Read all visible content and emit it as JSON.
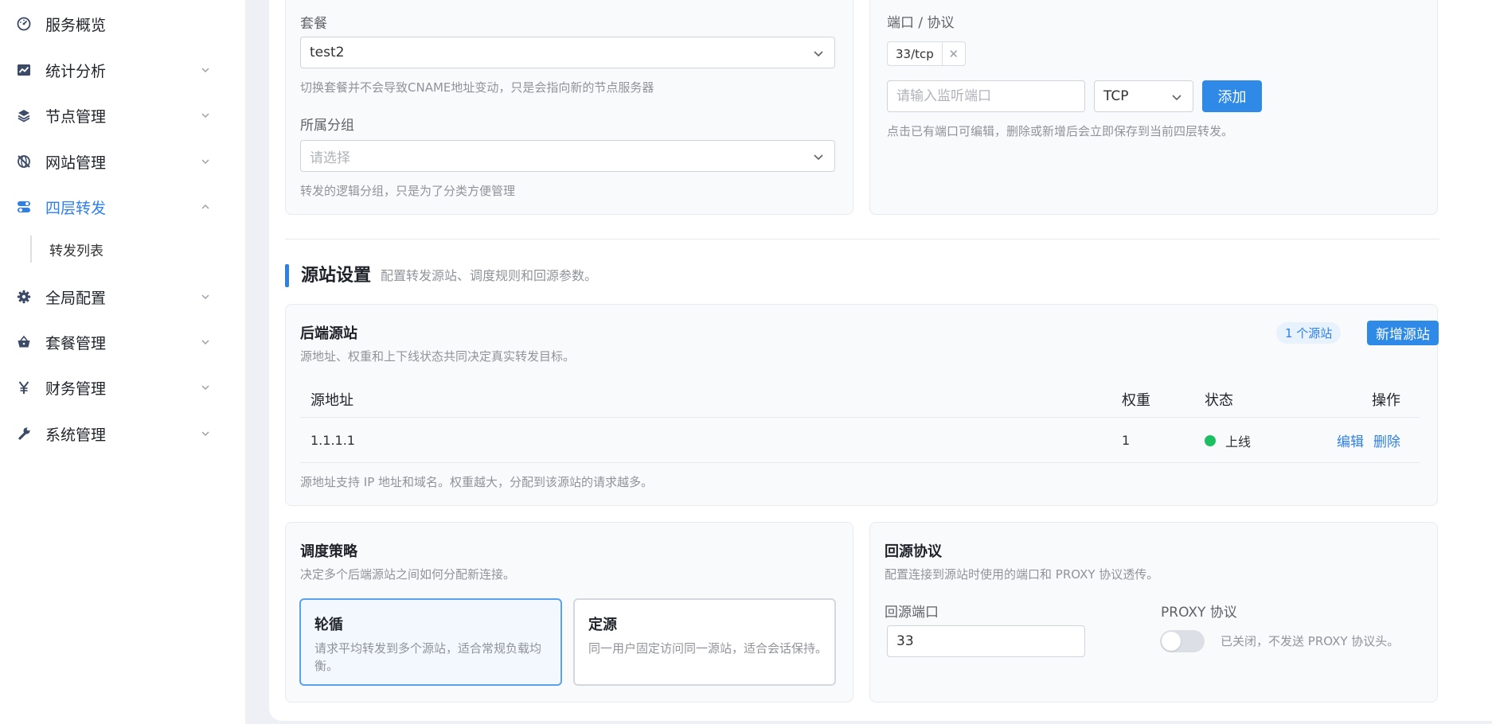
{
  "sidebar": {
    "items": [
      {
        "label": "服务概览",
        "icon": "gauge-icon"
      },
      {
        "label": "统计分析",
        "icon": "line-chart-icon"
      },
      {
        "label": "节点管理",
        "icon": "layers-icon"
      },
      {
        "label": "网站管理",
        "icon": "globe-off-icon"
      },
      {
        "label": "四层转发",
        "icon": "toggles-icon",
        "expanded": true
      },
      {
        "label": "全局配置",
        "icon": "gear-icon"
      },
      {
        "label": "套餐管理",
        "icon": "basket-icon"
      },
      {
        "label": "财务管理",
        "icon": "yen-icon"
      },
      {
        "label": "系统管理",
        "icon": "wrench-icon"
      }
    ],
    "subitems": [
      {
        "label": "转发列表"
      }
    ]
  },
  "form": {
    "package_label": "套餐",
    "package_value": "test2",
    "package_hint": "切换套餐并不会导致CNAME地址变动，只是会指向新的节点服务器",
    "group_label": "所属分组",
    "group_placeholder": "请选择",
    "group_hint": "转发的逻辑分组，只是为了分类方便管理",
    "ports_label": "端口 / 协议",
    "port_tags": [
      "33/tcp"
    ],
    "port_input_placeholder": "请输入监听端口",
    "protocol_value": "TCP",
    "add_button": "添加",
    "ports_hint": "点击已有端口可编辑，删除或新增后会立即保存到当前四层转发。"
  },
  "origin_section": {
    "title": "源站设置",
    "subtitle": "配置转发源站、调度规则和回源参数。"
  },
  "backend": {
    "title": "后端源站",
    "desc": "源地址、权重和上下线状态共同决定真实转发目标。",
    "count_badge": "1 个源站",
    "add_button": "新增源站",
    "columns": {
      "address": "源地址",
      "weight": "权重",
      "status": "状态",
      "actions": "操作"
    },
    "rows": [
      {
        "address": "1.1.1.1",
        "weight": "1",
        "status": "上线",
        "status_color": "#1dbf63",
        "edit": "编辑",
        "delete": "删除"
      }
    ],
    "hint": "源地址支持 IP 地址和域名。权重越大，分配到该源站的请求越多。"
  },
  "schedule": {
    "title": "调度策略",
    "desc": "决定多个后端源站之间如何分配新连接。",
    "options": [
      {
        "title": "轮循",
        "desc": "请求平均转发到多个源站，适合常规负载均衡。",
        "selected": true
      },
      {
        "title": "定源",
        "desc": "同一用户固定访问同一源站，适合会话保持。",
        "selected": false
      }
    ]
  },
  "back_origin": {
    "title": "回源协议",
    "desc": "配置连接到源站时使用的端口和 PROXY 协议透传。",
    "port_label": "回源端口",
    "port_value": "33",
    "proxy_label": "PROXY 协议",
    "proxy_enabled": false,
    "proxy_status": "已关闭，不发送 PROXY 协议头。"
  },
  "colors": {
    "accent": "#2e7fe6",
    "button": "#2e8ae6",
    "online": "#1dbf63"
  }
}
